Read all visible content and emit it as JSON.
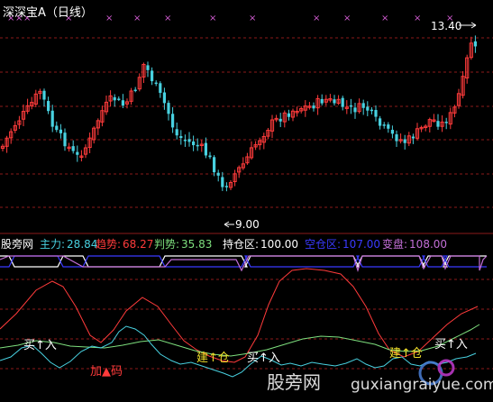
{
  "chart_title": "深深宝A（日线）",
  "colors": {
    "background": "#000000",
    "grid": "#8b1a1a",
    "up_candle": "#ff3b3b",
    "down_candle": "#48d1e0",
    "marker": "#d35cd3",
    "main_force": "#48d1e0",
    "trend": "#ff3b3b",
    "judge": "#7ee07e",
    "position_zone": "#ffffff",
    "empty_zone": "#3a3aff",
    "change_line": "#c36fd8",
    "text_white": "#ffffff",
    "text_yellow": "#f2e12a"
  },
  "price_pane": {
    "high_label": "13.40",
    "low_label": "9.00",
    "x_markers": [
      "×",
      "×",
      "×",
      "×",
      "×",
      "×",
      "×",
      "×",
      "×",
      "×",
      "×",
      "×",
      "×",
      "×"
    ]
  },
  "indicator_header": {
    "name": "股旁网",
    "items": [
      {
        "label": "主力:",
        "value": "28.84",
        "color": "#48d1e0"
      },
      {
        "label": "趋势:",
        "value": "68.27",
        "color": "#ff3b3b"
      },
      {
        "label": "判势:",
        "value": "35.83",
        "color": "#7ee07e"
      },
      {
        "label": "持仓区:",
        "value": "100.00",
        "color": "#ffffff"
      },
      {
        "label": "空仓区:",
        "value": "107.00",
        "color": "#3a3aff"
      },
      {
        "label": "变盘:",
        "value": "108.00",
        "color": "#c36fd8"
      }
    ]
  },
  "signals": [
    {
      "text": "买↑入",
      "color": "#ffffff"
    },
    {
      "text": "加▲码",
      "color": "#ff3b3b"
    },
    {
      "text": "建↑仓",
      "color": "#f2e12a"
    },
    {
      "text": "买↑入",
      "color": "#ffffff"
    },
    {
      "text": "建↑仓",
      "color": "#f2e12a"
    },
    {
      "text": "买↑入",
      "color": "#ffffff"
    }
  ],
  "watermarks": {
    "left": "股旁网",
    "right": "guxiangraiyue.com"
  },
  "chart_data": {
    "type": "candlestick",
    "title": "深深宝A（日线）",
    "price_high": 13.4,
    "price_low": 9.0,
    "series": [
      {
        "name": "主力",
        "last_value": 28.84
      },
      {
        "name": "趋势",
        "last_value": 68.27
      },
      {
        "name": "判势",
        "last_value": 35.83
      }
    ],
    "reference_levels": [
      {
        "name": "持仓区",
        "value": 100.0
      },
      {
        "name": "空仓区",
        "value": 107.0
      },
      {
        "name": "变盘",
        "value": 108.0
      }
    ]
  }
}
